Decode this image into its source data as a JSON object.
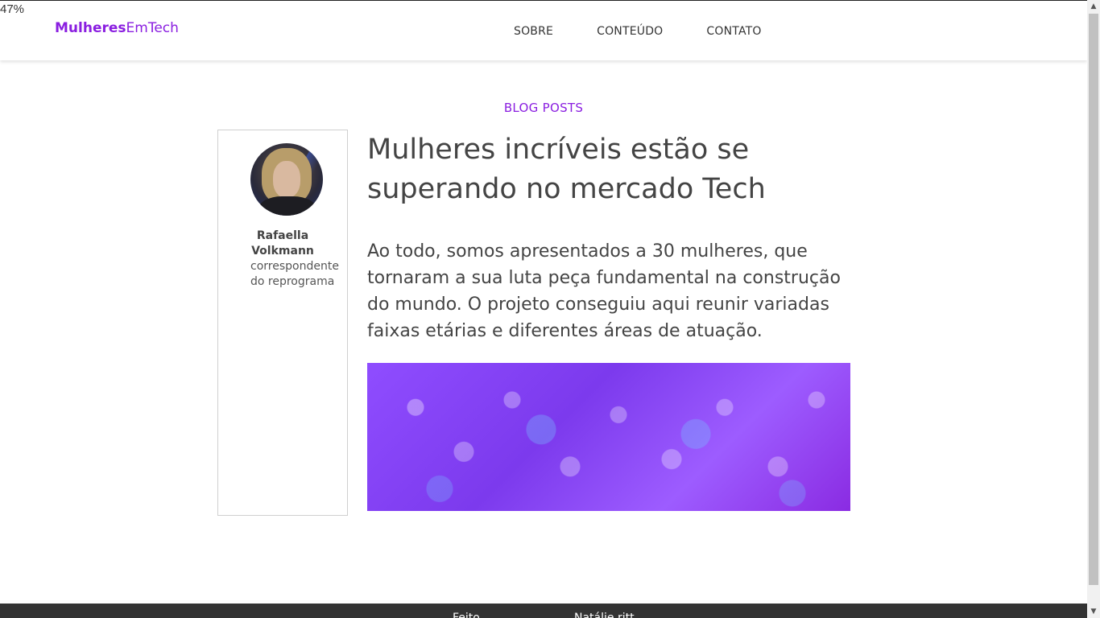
{
  "zoom": "47%",
  "brand": {
    "name_bold": "Mulheres",
    "name_light": "EmTech",
    "color": "#8a1ee0"
  },
  "nav": {
    "items": [
      {
        "label": "SOBRE"
      },
      {
        "label": "CONTEÚDO"
      },
      {
        "label": "CONTATO"
      }
    ]
  },
  "section": {
    "title": "BLOG POSTS"
  },
  "author": {
    "name": "Rafaella Volkmann",
    "role": "correspondente do reprograma"
  },
  "post": {
    "title": "Mulheres incríveis estão se superando no mercado Tech",
    "body": "Ao todo, somos apresentados a 30 mulheres, que tornaram a sua luta peça fundamental na construção do mundo. O projeto conseguiu aqui reunir variadas faixas etárias e diferentes áreas de atuação."
  },
  "footer": {
    "left_text": "Feito",
    "right_text": "Natálie ritt"
  },
  "colors": {
    "accent": "#8a1ee0",
    "footer_bg": "#333333",
    "text": "#444444"
  }
}
